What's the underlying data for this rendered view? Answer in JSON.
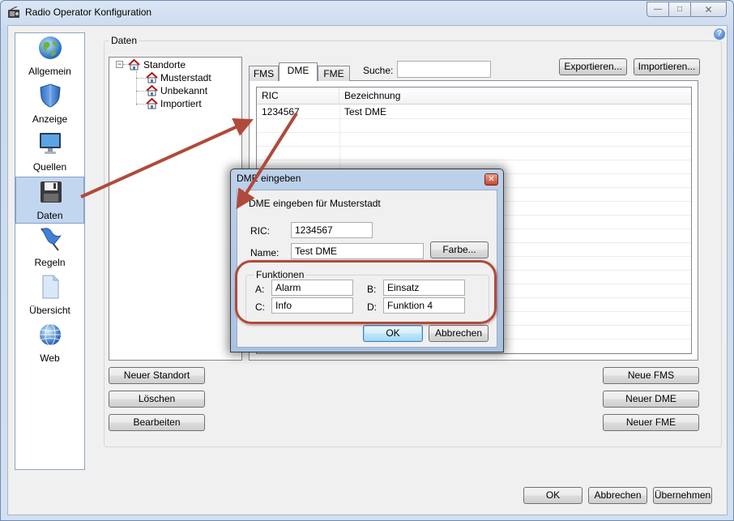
{
  "window": {
    "title": "Radio Operator Konfiguration",
    "controls": {
      "minimize": "—",
      "maximize": "□",
      "close": "✕"
    },
    "help": "?"
  },
  "nav": {
    "items": [
      {
        "label": "Allgemein",
        "icon": "globe-icon"
      },
      {
        "label": "Anzeige",
        "icon": "shield-icon"
      },
      {
        "label": "Quellen",
        "icon": "monitor-icon"
      },
      {
        "label": "Daten",
        "icon": "floppy-disk-icon",
        "selected": true
      },
      {
        "label": "Regeln",
        "icon": "flag-icon"
      },
      {
        "label": "Übersicht",
        "icon": "document-icon"
      },
      {
        "label": "Web",
        "icon": "web-globe-icon"
      }
    ]
  },
  "daten": {
    "group_title": "Daten",
    "tree": {
      "root": "Standorte",
      "toggle": "−",
      "children": [
        "Musterstadt",
        "Unbekannt",
        "Importiert"
      ]
    },
    "left_buttons": {
      "new_location": "Neuer Standort",
      "delete": "Löschen",
      "edit": "Bearbeiten"
    },
    "tabs": [
      "FMS",
      "DME",
      "FME"
    ],
    "active_tab": "DME",
    "search_label": "Suche:",
    "search_value": "",
    "export_label": "Exportieren...",
    "import_label": "Importieren...",
    "grid": {
      "columns": [
        "RIC",
        "Bezeichnung"
      ],
      "rows": [
        {
          "ric": "1234567",
          "bezeichnung": "Test DME"
        }
      ]
    },
    "right_buttons": {
      "new_fms": "Neue FMS",
      "new_dme": "Neuer DME",
      "new_fme": "Neuer FME"
    }
  },
  "dialog": {
    "title": "DME eingeben",
    "heading": "DME eingeben für Musterstadt",
    "ric_label": "RIC:",
    "ric_value": "1234567",
    "name_label": "Name:",
    "name_value": "Test DME",
    "color_button": "Farbe...",
    "functions_title": "Funktionen",
    "functions": [
      {
        "key": "A:",
        "value": "Alarm"
      },
      {
        "key": "B:",
        "value": "Einsatz"
      },
      {
        "key": "C:",
        "value": "Info"
      },
      {
        "key": "D:",
        "value": "Funktion 4"
      }
    ],
    "ok": "OK",
    "cancel": "Abbrechen",
    "close": "✕"
  },
  "footer": {
    "ok": "OK",
    "cancel": "Abbrechen",
    "apply": "Übernehmen"
  },
  "colors": {
    "annotation": "#b04a3a",
    "selection": "#c3d6ef"
  }
}
